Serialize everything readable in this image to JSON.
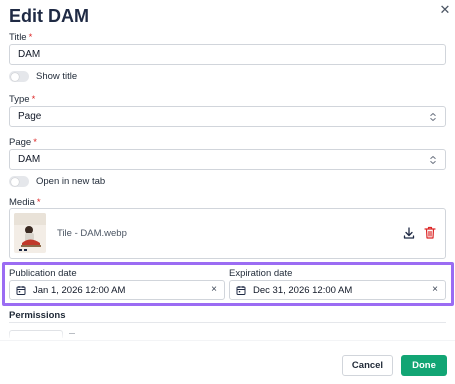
{
  "dialog": {
    "title": "Edit DAM",
    "close_icon": "close-icon"
  },
  "title_field": {
    "label": "Title",
    "required_mark": "*",
    "value": "DAM"
  },
  "show_title": {
    "label": "Show title",
    "checked": false
  },
  "type_field": {
    "label": "Type",
    "required_mark": "*",
    "value": "Page"
  },
  "page_field": {
    "label": "Page",
    "required_mark": "*",
    "value": "DAM"
  },
  "open_new_tab": {
    "label": "Open in new tab",
    "checked": false
  },
  "media": {
    "label": "Media",
    "required_mark": "*",
    "file_name": "Tile - DAM.webp",
    "download_icon": "download-icon",
    "delete_icon": "trash-icon"
  },
  "publication_date": {
    "label": "Publication date",
    "value": "Jan 1, 2026 12:00 AM",
    "clear": "×"
  },
  "expiration_date": {
    "label": "Expiration date",
    "value": "Dec 31, 2026 12:00 AM",
    "clear": "×"
  },
  "permissions": {
    "label": "Permissions"
  },
  "footer": {
    "cancel_label": "Cancel",
    "done_label": "Done"
  },
  "colors": {
    "accent": "#12a574",
    "required": "#dc2626",
    "highlight": "#9b6cf3",
    "delete": "#dc2626"
  }
}
